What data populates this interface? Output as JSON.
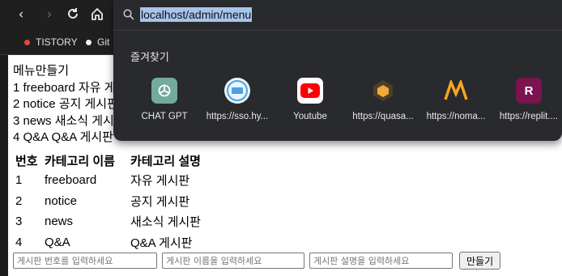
{
  "browser": {
    "address": "localhost/admin/menu",
    "bookmarks": [
      {
        "label": "TISTORY",
        "color": "#e8453c"
      },
      {
        "label": "Git",
        "color": "#f0f0f0"
      }
    ]
  },
  "omnibox": {
    "favorites_title": "즐겨찾기",
    "shortcuts": [
      {
        "label": "CHAT GPT",
        "icon": "chatgpt-icon",
        "color": "#74aa9c"
      },
      {
        "label": "https://sso.hy...",
        "icon": "sso-icon",
        "color": "#4aa3df"
      },
      {
        "label": "Youtube",
        "icon": "youtube-icon",
        "color": "#ff0000"
      },
      {
        "label": "https://quasa...",
        "icon": "quasar-icon",
        "color": "#5a4a2a"
      },
      {
        "label": "https://noma...",
        "icon": "nomad-icon",
        "color": "#f5a623"
      },
      {
        "label": "https://replit....",
        "icon": "replit-icon",
        "color": "#7b1450"
      }
    ]
  },
  "page": {
    "heading": "메뉴만들기",
    "list_lines": [
      "1 freeboard 자유 게시판",
      "2 notice 공지 게시판",
      "3 news 새소식 게시판",
      "4 Q&A Q&A 게시판"
    ],
    "table": {
      "headers": [
        "번호",
        "카테고리 이름",
        "카테고리 설명"
      ],
      "rows": [
        [
          "1",
          "freeboard",
          "자유 게시판"
        ],
        [
          "2",
          "notice",
          "공지 게시판"
        ],
        [
          "3",
          "news",
          "새소식 게시판"
        ],
        [
          "4",
          "Q&A",
          "Q&A 게시판"
        ]
      ]
    },
    "form": {
      "number_placeholder": "게시판 번호를 입력하세요",
      "name_placeholder": "게시판 이름을 입력하세요",
      "desc_placeholder": "게시판 설명을 입력하세요",
      "submit_label": "만들기"
    }
  }
}
